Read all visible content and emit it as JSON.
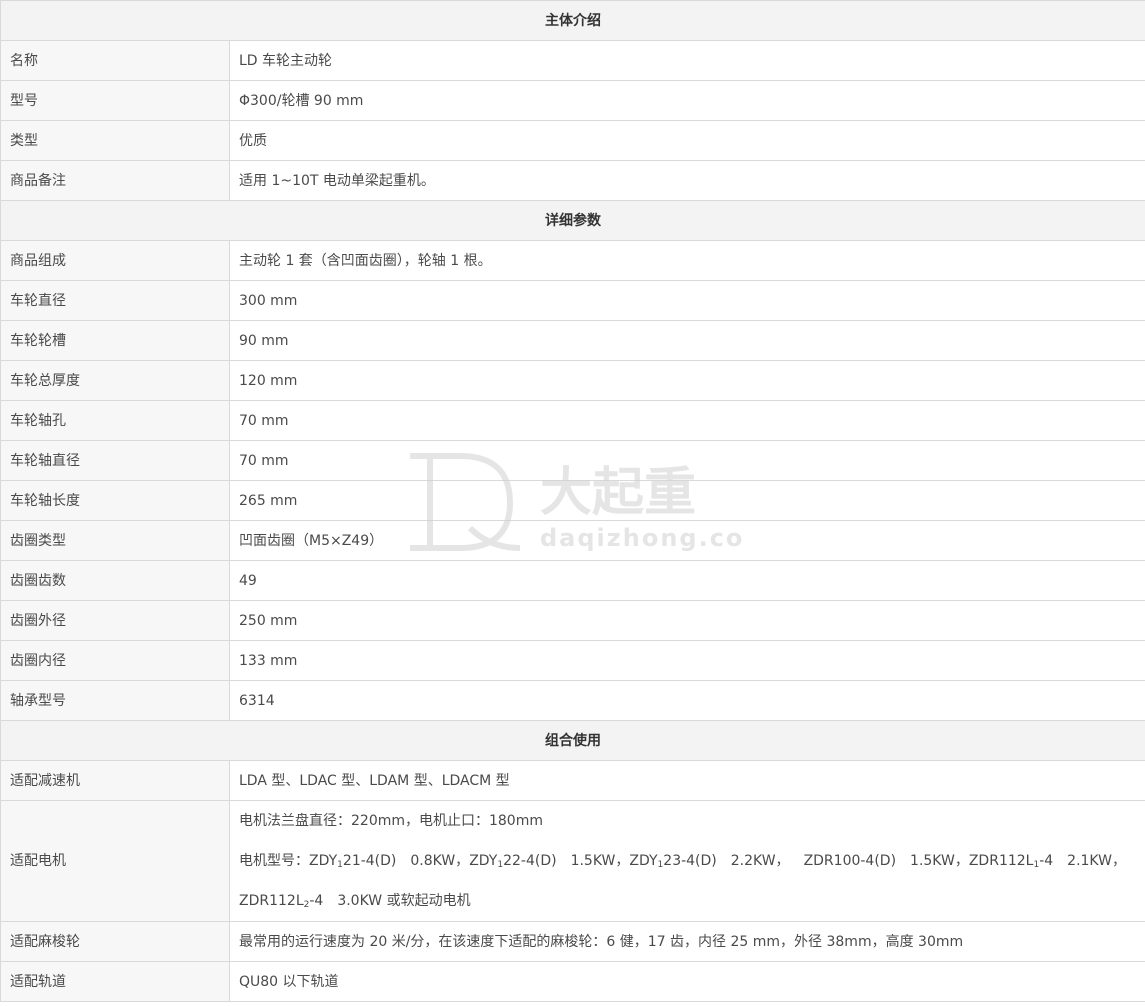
{
  "sections": {
    "intro": "主体介绍",
    "details": "详细参数",
    "combo": "组合使用"
  },
  "intro_rows": [
    {
      "label": "名称",
      "value": "LD 车轮主动轮"
    },
    {
      "label": "型号",
      "value": "Φ300/轮槽 90 mm"
    },
    {
      "label": "类型",
      "value": "优质"
    },
    {
      "label": "商品备注",
      "value": "适用 1~10T 电动单梁起重机。"
    }
  ],
  "detail_rows": [
    {
      "label": "商品组成",
      "value": "主动轮 1 套（含凹面齿圈），轮轴 1 根。"
    },
    {
      "label": "车轮直径",
      "value": "300 mm"
    },
    {
      "label": "车轮轮槽",
      "value": "90 mm"
    },
    {
      "label": "车轮总厚度",
      "value": "120 mm"
    },
    {
      "label": "车轮轴孔",
      "value": "70 mm"
    },
    {
      "label": "车轮轴直径",
      "value": "70 mm"
    },
    {
      "label": "车轮轴长度",
      "value": "265 mm"
    },
    {
      "label": "齿圈类型",
      "value": "凹面齿圈（M5×Z49）"
    },
    {
      "label": "齿圈齿数",
      "value": "49"
    },
    {
      "label": "齿圈外径",
      "value": "250 mm"
    },
    {
      "label": "齿圈内径",
      "value": "133 mm"
    },
    {
      "label": "轴承型号",
      "value": "6314"
    }
  ],
  "combo": {
    "reducer": {
      "label": "适配减速机",
      "value": "LDA 型、LDAC 型、LDAM 型、LDACM 型"
    },
    "motor": {
      "label": "适配电机",
      "flange": "电机法兰盘直径：220mm，电机止口：180mm",
      "models_prefix": "电机型号：",
      "m1a": "ZDY",
      "m1s": "1",
      "m1b": "21-4(D)",
      "m1p": "0.8KW，",
      "m2a": "ZDY",
      "m2s": "1",
      "m2b": "22-4(D)",
      "m2p": "1.5KW，",
      "m3a": "ZDY",
      "m3s": "1",
      "m3b": "23-4(D)",
      "m3p": "2.2KW，",
      "m4": "ZDR100-4(D)",
      "m4p": "1.5KW，",
      "m5a": "ZDR112L",
      "m5s": "1",
      "m5b": "-4",
      "m5p": "2.1KW，",
      "m6a": "ZDR112L",
      "m6s": "2",
      "m6b": "-4",
      "m6p": "3.0KW 或软起动电机"
    },
    "wheel": {
      "label": "适配麻梭轮",
      "value": "最常用的运行速度为 20 米/分，在该速度下适配的麻梭轮：6 健，17 齿，内径 25 mm，外径 38mm，高度 30mm"
    },
    "rail": {
      "label": "适配轨道",
      "value": "QU80 以下轨道"
    }
  },
  "watermark": {
    "cn": "大起重",
    "en": "daqizhong.com",
    "color": "#c8c8c8"
  }
}
